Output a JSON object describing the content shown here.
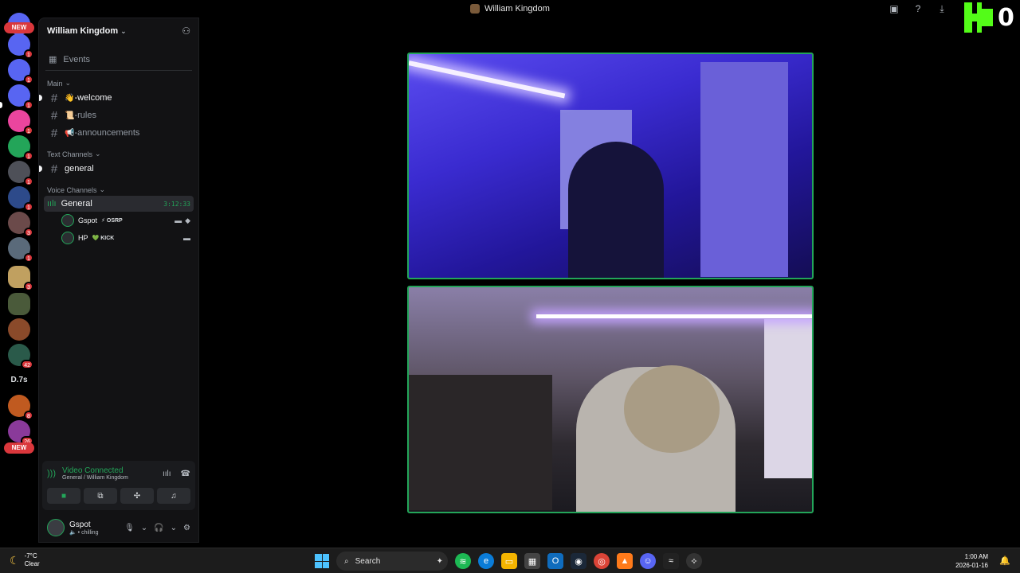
{
  "window": {
    "title": "William Kingdom"
  },
  "kick": {
    "count": "0",
    "color": "#53fc18"
  },
  "rail": {
    "new_top": "NEW",
    "new_bottom": "NEW",
    "badges": [
      "1",
      "1",
      "1",
      "1",
      "1",
      "1",
      "1",
      "3",
      "1",
      "3",
      "",
      "",
      "42",
      "",
      "8",
      "26"
    ],
    "text_server": "D.7s"
  },
  "sidebar": {
    "server_name": "William Kingdom",
    "events": "Events",
    "categories": {
      "main": "Main",
      "text": "Text Channels",
      "voice": "Voice Channels"
    },
    "main_channels": [
      {
        "emoji": "👋",
        "name": "-welcome"
      },
      {
        "emoji": "📜",
        "name": "-rules"
      },
      {
        "emoji": "📢",
        "name": "-announcements"
      }
    ],
    "text_channel": "general",
    "voice_channel": {
      "name": "General",
      "timer": "3:12:33"
    },
    "voice_users": [
      {
        "name": "Gspot",
        "tag": "OSRP",
        "tag_icon": "⚡"
      },
      {
        "name": "HP",
        "tag": "KICK",
        "tag_icon": "💚"
      }
    ]
  },
  "voice_panel": {
    "status": "Video Connected",
    "location": "General / William Kingdom"
  },
  "user_panel": {
    "name": "Gspot",
    "status": "chilling"
  },
  "taskbar": {
    "weather_temp": "-7°C",
    "weather_desc": "Clear",
    "search_placeholder": "Search",
    "time": "1:00 AM",
    "date": "2026-01-16"
  },
  "colors": {
    "accent_green": "#23a559",
    "badge_red": "#da373c"
  }
}
